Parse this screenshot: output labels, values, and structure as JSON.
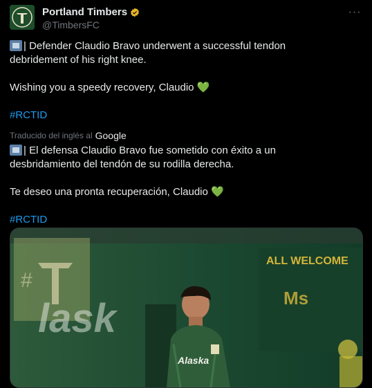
{
  "author": {
    "name": "Portland Timbers",
    "handle": "@TimbersFC"
  },
  "menu": {
    "more_icon": "···"
  },
  "tweet": {
    "line1": "| Defender Claudio Bravo underwent a successful tendon",
    "line2": "debridement of his right knee.",
    "line3": "Wishing you a speedy recovery, Claudio",
    "hashtag": "#RCTID",
    "heart": "💚"
  },
  "translation": {
    "label": "Traducido del inglés al",
    "provider": "Google",
    "line1": "| El defensa Claudio Bravo fue sometido con éxito a un",
    "line2": "desbridamiento del tendón de su rodilla derecha.",
    "line3": "Te deseo una pronta recuperación, Claudio",
    "hashtag": "#RCTID"
  },
  "media": {
    "stadium_text": "lask",
    "sign_text": "ALL WELCOME",
    "jersey_text": "Alaska"
  },
  "colors": {
    "background": "#000000",
    "text": "#e7e9ea",
    "muted": "#71767b",
    "link": "#1d9bf0",
    "verified": "#e8b52a"
  }
}
